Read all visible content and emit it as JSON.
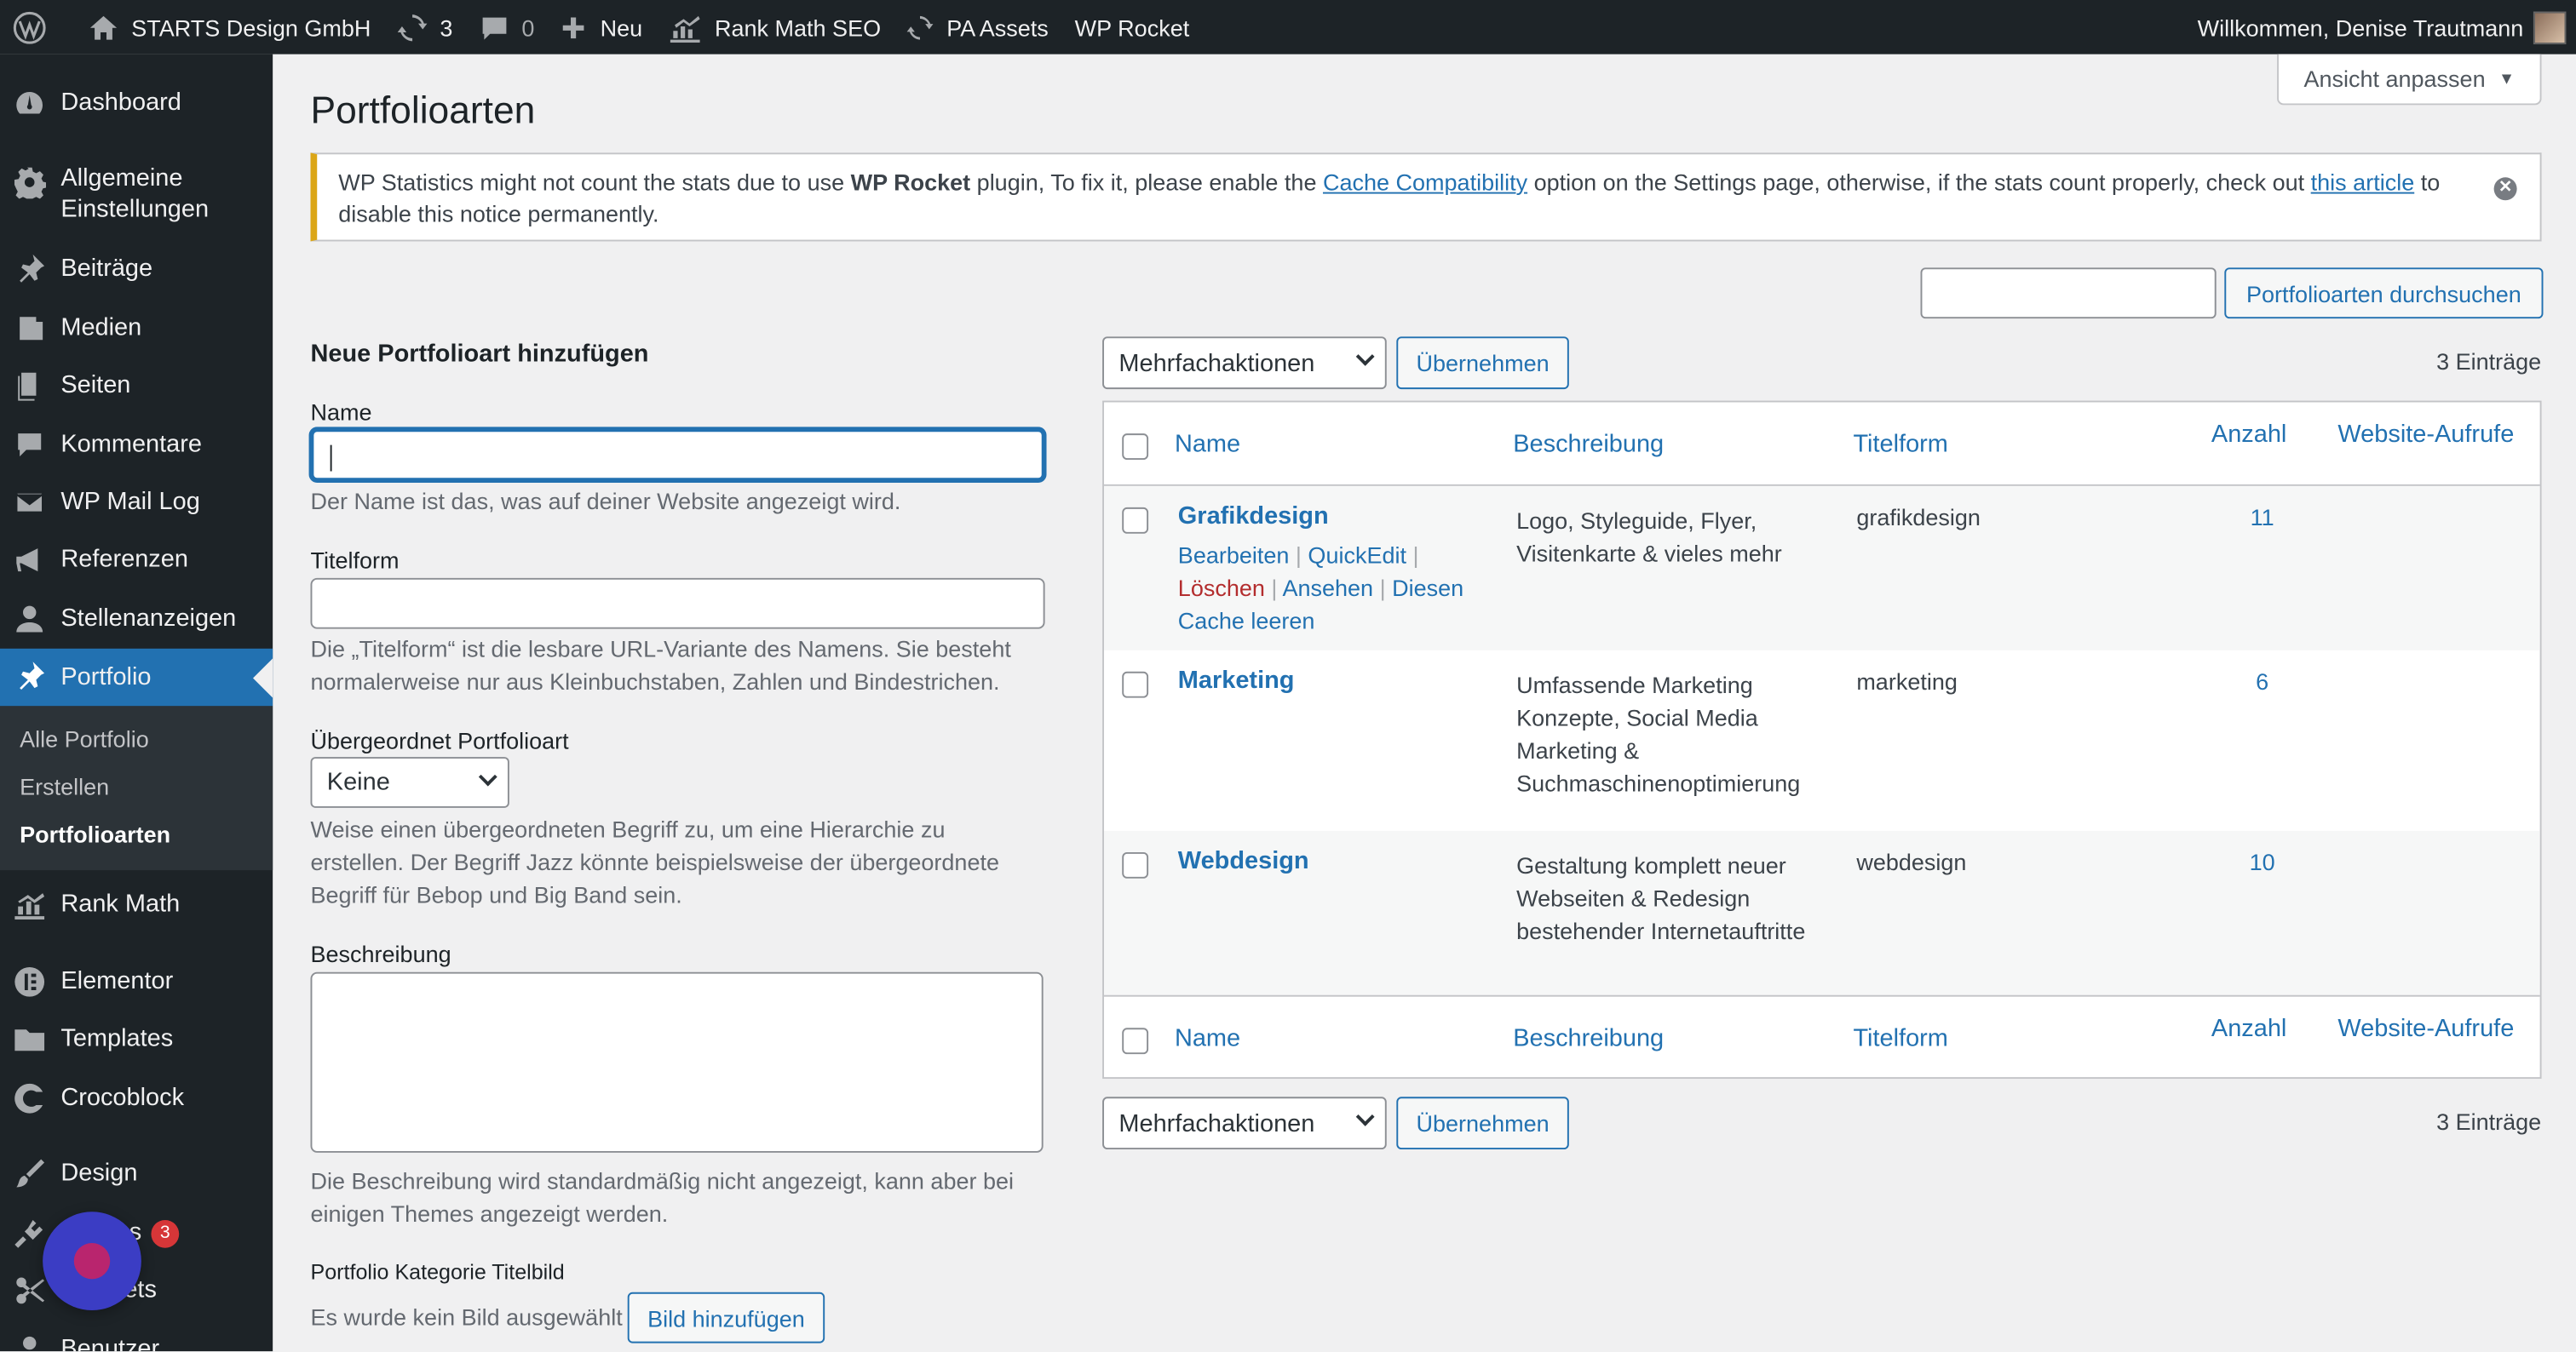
{
  "adminbar": {
    "site_name": "STARTS Design GmbH",
    "updates_count": "3",
    "comments_count": "0",
    "new_label": "Neu",
    "rankmath_label": "Rank Math SEO",
    "pa_assets_label": "PA Assets",
    "wp_rocket_label": "WP Rocket",
    "greeting": "Willkommen, Denise Trautmann"
  },
  "sidebar": {
    "items": [
      {
        "label": "Dashboard",
        "icon": "dashboard-icon"
      },
      {
        "label": "Allgemeine Einstellungen",
        "icon": "gear-icon"
      },
      {
        "label": "Beiträge",
        "icon": "pin-icon"
      },
      {
        "label": "Medien",
        "icon": "media-icon"
      },
      {
        "label": "Seiten",
        "icon": "pages-icon"
      },
      {
        "label": "Kommentare",
        "icon": "comment-icon"
      },
      {
        "label": "WP Mail Log",
        "icon": "mail-icon"
      },
      {
        "label": "Referenzen",
        "icon": "megaphone-icon"
      },
      {
        "label": "Stellenanzeigen",
        "icon": "user-icon"
      },
      {
        "label": "Portfolio",
        "icon": "pin-icon"
      },
      {
        "label": "Rank Math",
        "icon": "chart-icon"
      },
      {
        "label": "Elementor",
        "icon": "elementor-icon"
      },
      {
        "label": "Templates",
        "icon": "folder-icon"
      },
      {
        "label": "Crocoblock",
        "icon": "crocoblock-icon"
      },
      {
        "label": "Design",
        "icon": "brush-icon"
      },
      {
        "label": "Plugins",
        "icon": "plugin-icon",
        "badge": "3"
      },
      {
        "label": "Snippets",
        "icon": "scissors-icon"
      },
      {
        "label": "Benutzer",
        "icon": "user-icon"
      }
    ],
    "submenu": [
      "Alle Portfolio",
      "Erstellen",
      "Portfolioarten"
    ]
  },
  "screen_options_label": "Ansicht anpassen",
  "page_title": "Portfolioarten",
  "notice": {
    "text_1": "WP Statistics might not count the stats due to use ",
    "bold": "WP Rocket",
    "text_2": " plugin, To fix it, please enable the ",
    "link_1": "Cache Compatibility",
    "text_3": " option on the Settings page, otherwise, if the stats count properly, check out ",
    "link_2": "this article",
    "text_4": " to disable this notice permanently."
  },
  "search": {
    "button_label": "Portfolioarten durchsuchen",
    "value": ""
  },
  "form": {
    "heading": "Neue Portfolioart hinzufügen",
    "name_label": "Name",
    "name_value": "",
    "name_desc": "Der Name ist das, was auf deiner Website angezeigt wird.",
    "slug_label": "Titelform",
    "slug_value": "",
    "slug_desc": "Die „Titelform“ ist die lesbare URL-Variante des Namens. Sie besteht normalerweise nur aus Kleinbuchstaben, Zahlen und Bindestrichen.",
    "parent_label": "Übergeordnet Portfolioart",
    "parent_value": "Keine",
    "parent_desc": "Weise einen übergeordneten Begriff zu, um eine Hierarchie zu erstellen. Der Begriff Jazz könnte beispielsweise der übergeordnete Begriff für Bebop und Big Band sein.",
    "desc_label": "Beschreibung",
    "desc_value": "",
    "desc_desc": "Die Beschreibung wird standardmäßig nicht angezeigt, kann aber bei einigen Themes angezeigt werden.",
    "image_label": "Portfolio Kategorie Titelbild",
    "image_none": "Es wurde kein Bild ausgewählt",
    "image_button": "Bild hinzufügen"
  },
  "bulk": {
    "select_value": "Mehrfachaktionen",
    "apply_label": "Übernehmen",
    "items_count": "3 Einträge"
  },
  "table": {
    "columns": [
      "Name",
      "Beschreibung",
      "Titelform",
      "Anzahl",
      "Website-Aufrufe"
    ],
    "rows": [
      {
        "name": "Grafikdesign",
        "description": "Logo, Styleguide, Flyer, Visitenkarte & vieles mehr",
        "slug": "grafikdesign",
        "count": "11"
      },
      {
        "name": "Marketing",
        "description": "Umfassende Marketing Konzepte, Social Media Marketing & Suchmaschinenoptimierung",
        "slug": "marketing",
        "count": "6"
      },
      {
        "name": "Webdesign",
        "description": "Gestaltung komplett neuer Webseiten & Redesign bestehender Internetauftritte",
        "slug": "webdesign",
        "count": "10"
      }
    ],
    "row_actions": {
      "edit": "Bearbeiten",
      "quickedit": "QuickEdit",
      "delete": "Löschen",
      "view": "Ansehen",
      "cache": "Diesen Cache leeren"
    }
  },
  "colors": {
    "adminbar": "#1d2327",
    "accent": "#2271b1",
    "notice_border": "#dba617",
    "delete": "#b32d2e"
  }
}
